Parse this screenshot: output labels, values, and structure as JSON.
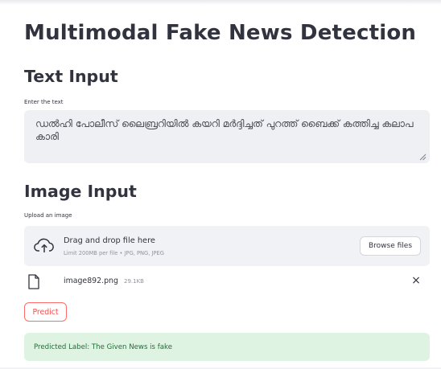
{
  "app": {
    "title": "Multimodal Fake News Detection"
  },
  "text_section": {
    "heading": "Text Input",
    "label": "Enter the text",
    "value": "ഡൽഹി പോലീസ് ലൈബ്രറിയിൽ കയറി മർദ്ദിച്ചത് പുറത്ത് ബൈക്ക് കത്തിച്ച കലാപകാരി"
  },
  "image_section": {
    "heading": "Image Input",
    "label": "Upload an image",
    "dropzone": {
      "main_text": "Drag and drop file here",
      "limit_text": "Limit 200MB per file • JPG, PNG, JPEG",
      "browse_label": "Browse files"
    },
    "uploaded_file": {
      "name": "image892.png",
      "size": "29.1KB"
    }
  },
  "actions": {
    "predict_label": "Predict"
  },
  "result": {
    "text": "Predicted Label: The Given News is fake"
  },
  "icons": {
    "upload": "cloud-upload-icon",
    "file": "file-icon",
    "remove": "close-icon",
    "resize": "resize-handle-icon"
  },
  "colors": {
    "primary": "#ff4b4b",
    "success_bg": "#dff3e3",
    "success_text": "#177233",
    "input_bg": "#eef0f4"
  }
}
